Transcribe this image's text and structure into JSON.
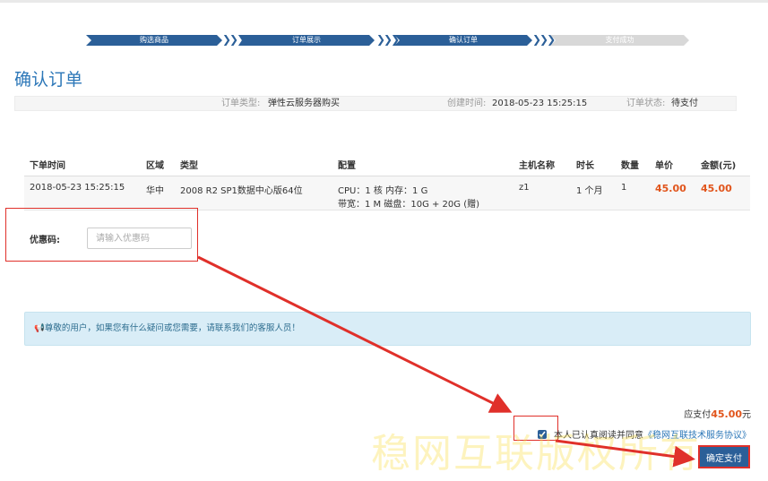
{
  "steps": [
    "购选商品",
    "订单展示",
    "确认订单",
    "支付成功"
  ],
  "page_title": "确认订单",
  "info": {
    "order_type_label": "订单类型:",
    "order_type_value": "弹性云服务器购买",
    "created_label": "创建时间:",
    "created_value": "2018-05-23 15:25:15",
    "status_label": "订单状态:",
    "status_value": "待支付"
  },
  "table": {
    "headers": [
      "下单时间",
      "区域",
      "类型",
      "配置",
      "主机名称",
      "时长",
      "数量",
      "单价",
      "金额(元)"
    ],
    "row": {
      "time": "2018-05-23 15:25:15",
      "region": "华中",
      "type": "2008 R2 SP1数据中心版64位",
      "config_line1": "CPU：1 核 内存：1 G",
      "config_line2": "带宽：1 M 磁盘：10G + 20G (赠)",
      "host": "z1",
      "duration": "1 个月",
      "quantity": "1",
      "unit_price": "45.00",
      "amount": "45.00"
    }
  },
  "coupon": {
    "label": "优惠码:",
    "placeholder": "请输入优惠码"
  },
  "notice": "📢尊敬的用户，如果您有什么疑问或您需要，请联系我们的客服人员！",
  "payment": {
    "prefix": "应支付",
    "amount": "45.00",
    "suffix": "元"
  },
  "agreement": {
    "text": "本人已认真阅读并同意",
    "link": "《稳网互联技术服务协议》",
    "checked": true
  },
  "confirm_button": "确定支付",
  "watermark": "稳网互联版权所有",
  "colors": {
    "accent": "#2b5f98",
    "price": "#e1551c",
    "annotation": "#e0302a"
  }
}
